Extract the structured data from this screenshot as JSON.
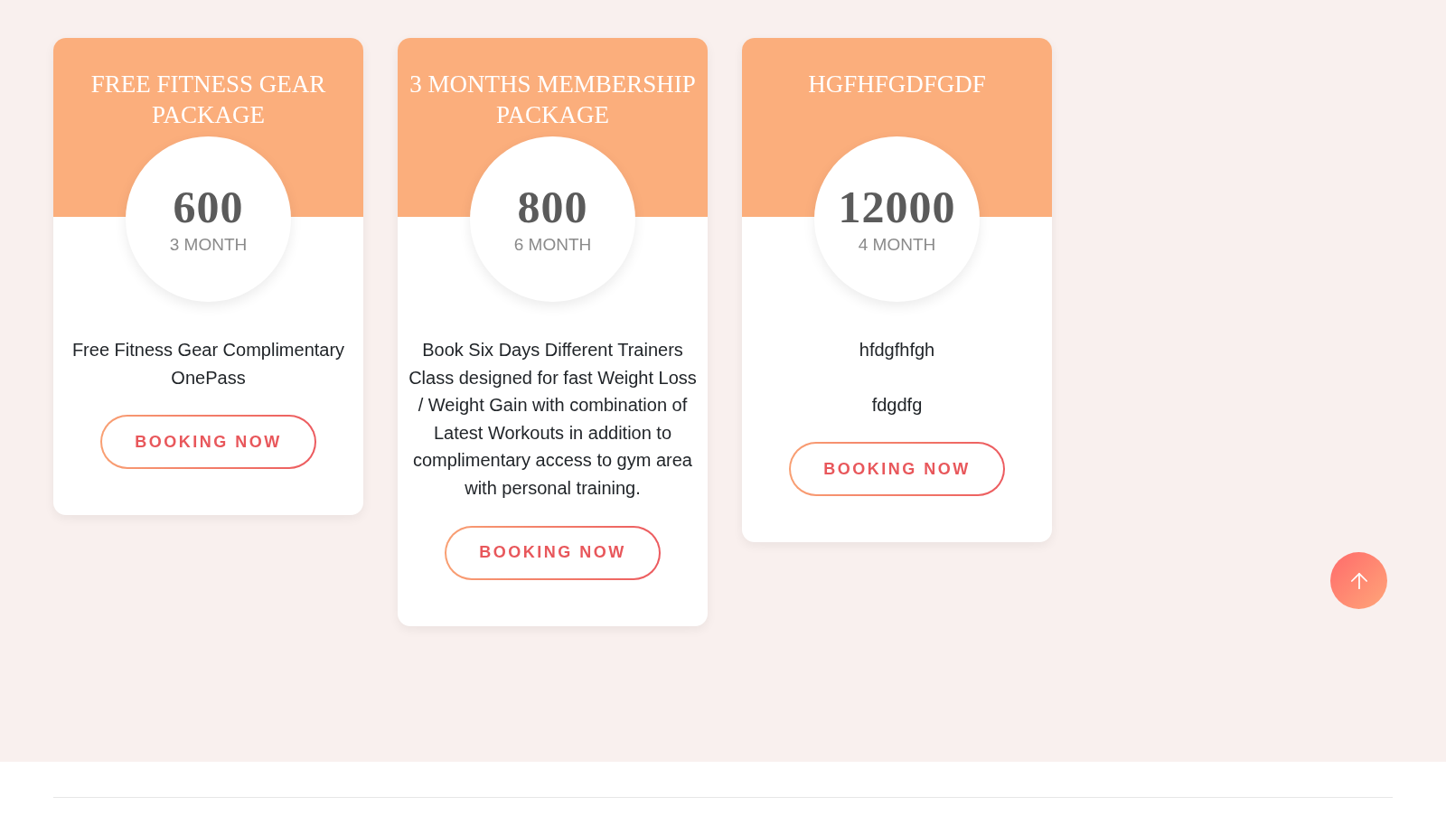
{
  "packages": [
    {
      "title": "FREE FITNESS GEAR PACKAGE",
      "price": "600",
      "duration": "3 MONTH",
      "description": [
        "Free Fitness Gear Complimentary OnePass"
      ],
      "button": "BOOKING NOW"
    },
    {
      "title": "3 MONTHS MEMBERSHIP PACKAGE",
      "price": "800",
      "duration": "6 MONTH",
      "description": [
        "Book Six Days Different Trainers Class designed for fast Weight Loss / Weight Gain with combination of Latest Workouts in addition to complimentary access to gym area with personal training."
      ],
      "button": "BOOKING NOW"
    },
    {
      "title": "HGFHFGDFGDF",
      "price": "12000",
      "duration": "4 MONTH",
      "description": [
        "hfdgfhfgh",
        "fdgdfg"
      ],
      "button": "BOOKING NOW"
    }
  ]
}
